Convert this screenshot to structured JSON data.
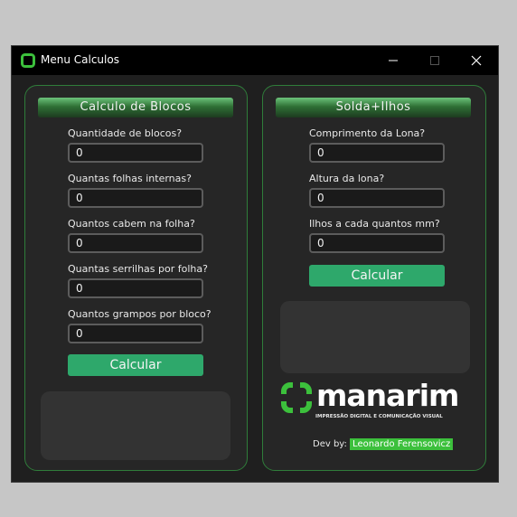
{
  "window": {
    "title": "Menu Calculos",
    "icon": "manarim-app-icon"
  },
  "colors": {
    "accent_green": "#2ea86b",
    "panel_border": "#2f7d3a",
    "dev_highlight": "#3cc03c"
  },
  "blocos": {
    "header": "Calculo de Blocos",
    "fields": [
      {
        "label": "Quantidade de blocos?",
        "value": "0"
      },
      {
        "label": "Quantas folhas internas?",
        "value": "0"
      },
      {
        "label": "Quantos cabem na folha?",
        "value": "0"
      },
      {
        "label": "Quantas serrilhas por folha?",
        "value": "0"
      },
      {
        "label": "Quantos grampos por bloco?",
        "value": "0"
      }
    ],
    "button": "Calcular"
  },
  "solda": {
    "header": "Solda+Ilhos",
    "fields": [
      {
        "label": "Comprimento da Lona?",
        "value": "0"
      },
      {
        "label": "Altura da lona?",
        "value": "0"
      },
      {
        "label": "Ilhos a cada quantos mm?",
        "value": "0"
      }
    ],
    "button": "Calcular"
  },
  "branding": {
    "logo_word": "manarim",
    "logo_tagline": "IMPRESSÃO DIGITAL E COMUNICAÇÃO VISUAL",
    "dev_prefix": "Dev by:",
    "dev_name": "Leonardo Ferensovicz"
  }
}
